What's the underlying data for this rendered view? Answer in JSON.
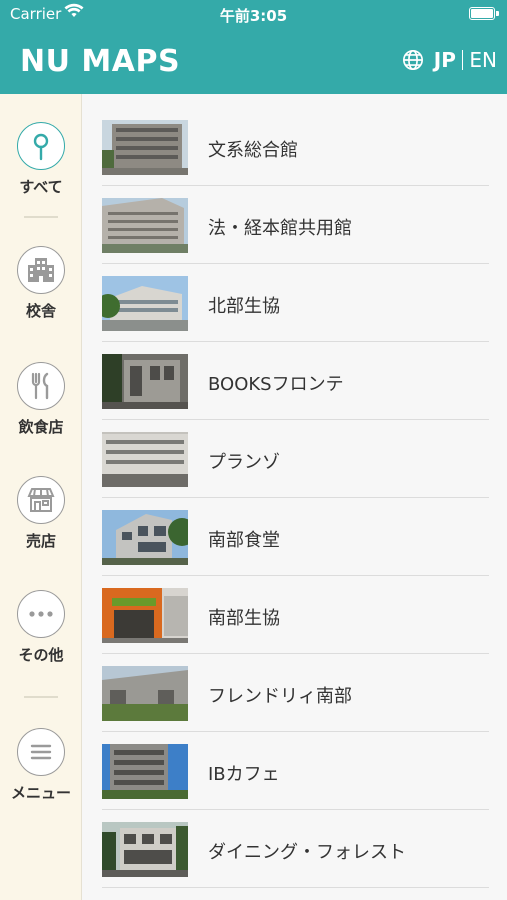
{
  "status_bar": {
    "carrier": "Carrier",
    "time": "午前3:05"
  },
  "header": {
    "logo": "NU MAPS",
    "lang_jp": "JP",
    "lang_en": "EN"
  },
  "sidebar": {
    "items": [
      {
        "label": "すべて",
        "icon": "map-pin-icon",
        "active": true
      },
      {
        "label": "校舎",
        "icon": "building-icon"
      },
      {
        "label": "飲食店",
        "icon": "fork-knife-icon"
      },
      {
        "label": "売店",
        "icon": "store-icon"
      },
      {
        "label": "その他",
        "icon": "more-dots-icon"
      },
      {
        "label": "メニュー",
        "icon": "menu-icon"
      }
    ]
  },
  "places": [
    {
      "name": "文系総合館"
    },
    {
      "name": "法・経本館共用館"
    },
    {
      "name": "北部生協"
    },
    {
      "name": "BOOKSフロンテ"
    },
    {
      "name": "プランゾ"
    },
    {
      "name": "南部食堂"
    },
    {
      "name": "南部生協"
    },
    {
      "name": "フレンドリィ南部"
    },
    {
      "name": "IBカフェ"
    },
    {
      "name": "ダイニング・フォレスト"
    }
  ],
  "colors": {
    "primary": "#34aaa9",
    "sidebar_bg": "#fbf6e8",
    "list_bg": "#f7f7f7"
  }
}
